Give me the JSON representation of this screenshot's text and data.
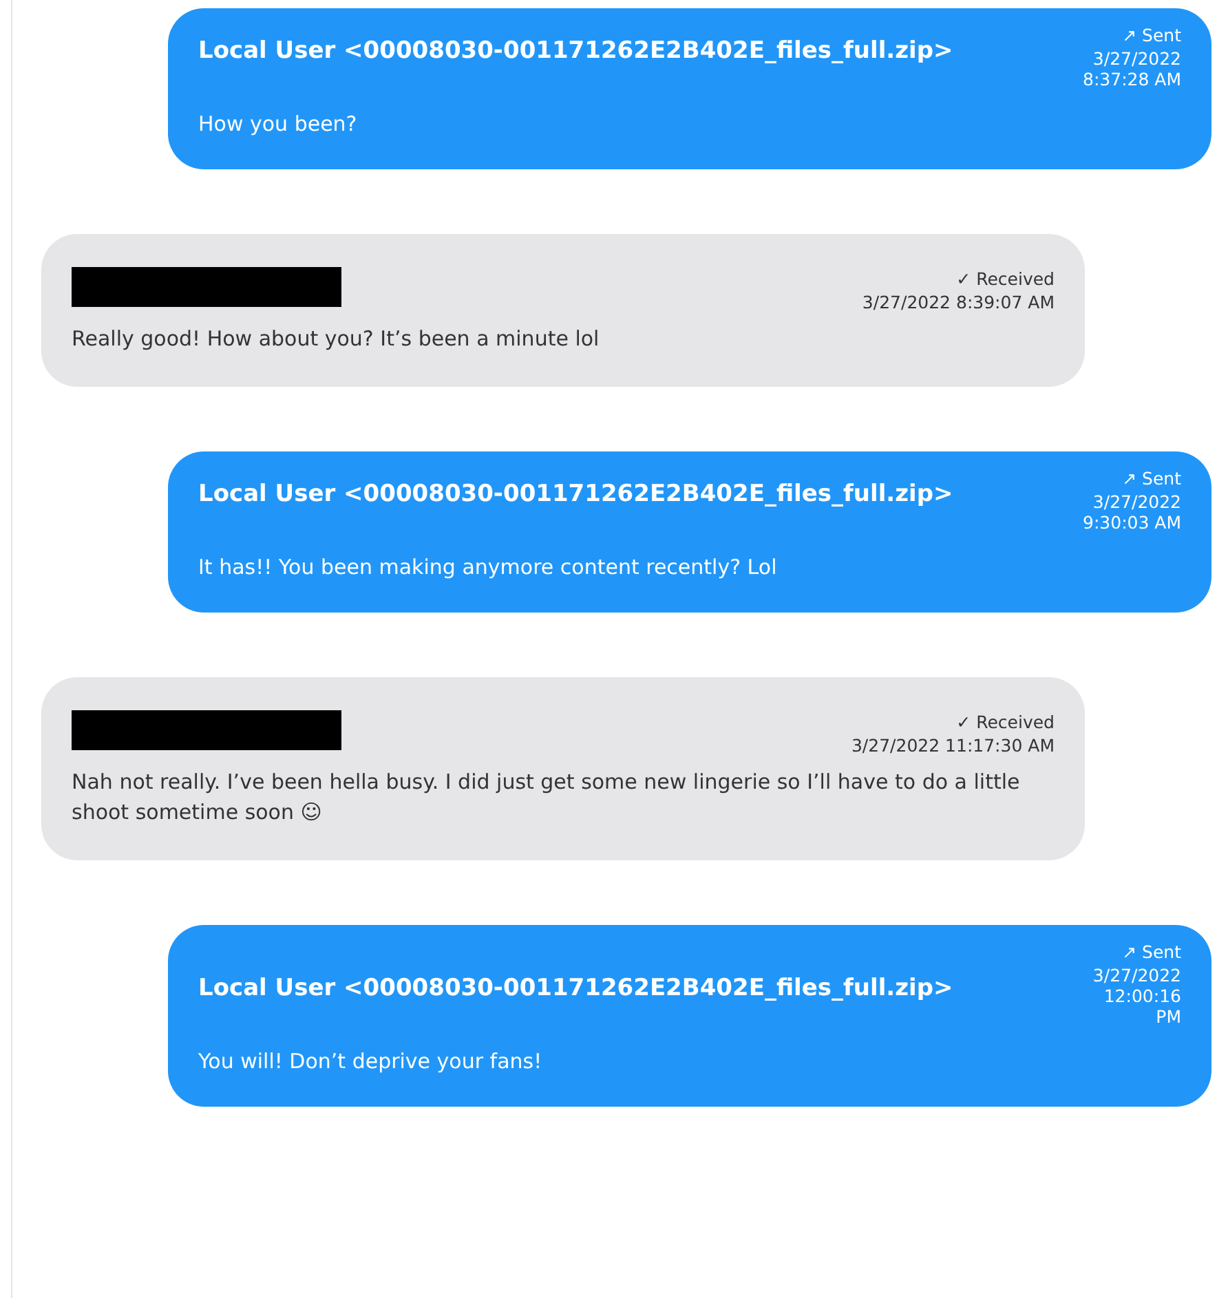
{
  "messages": [
    {
      "kind": "sent",
      "sender": "Local User <00008030-001171262E2B402E_files_full.zip>",
      "status": "↗ Sent",
      "timestamp": "3/27/2022 8:37:28 AM",
      "text": "How you been?"
    },
    {
      "kind": "received",
      "sender_redacted": true,
      "status": "✓ Received",
      "timestamp": "3/27/2022 8:39:07 AM",
      "text": "Really good! How about you? It’s been a minute lol"
    },
    {
      "kind": "sent",
      "sender": "Local User <00008030-001171262E2B402E_files_full.zip>",
      "status": "↗ Sent",
      "timestamp": "3/27/2022 9:30:03 AM",
      "text": "It has!! You been making anymore content recently? Lol"
    },
    {
      "kind": "received",
      "sender_redacted": true,
      "status": "✓ Received",
      "timestamp": "3/27/2022 11:17:30 AM",
      "text": "Nah not really. I’ve been hella busy. I did just get some new lingerie so I’ll have to do a little shoot sometime soon ☺"
    },
    {
      "kind": "sent",
      "sender": "Local User <00008030-001171262E2B402E_files_full.zip>",
      "status": "↗ Sent",
      "timestamp": "3/27/2022 12:00:16 PM",
      "text": "You will! Don’t deprive your fans!"
    }
  ]
}
